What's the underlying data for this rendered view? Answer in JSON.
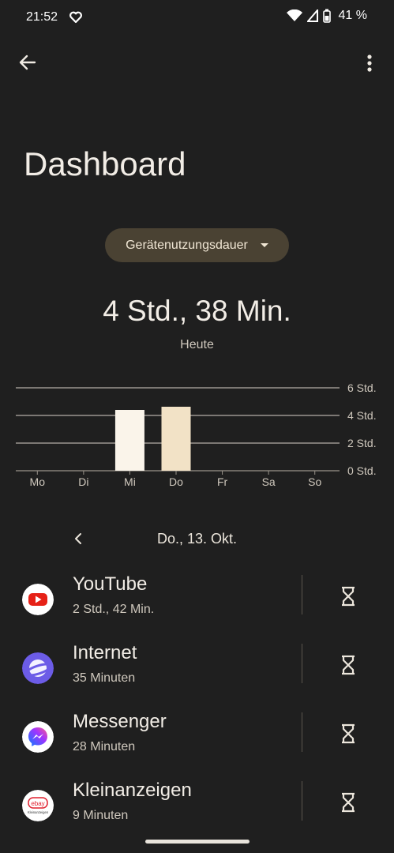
{
  "status_bar": {
    "time": "21:52",
    "battery_text": "41 %"
  },
  "header": {
    "title": "Dashboard"
  },
  "dropdown": {
    "label": "Gerätenutzungsdauer"
  },
  "summary": {
    "total": "4 Std., 38 Min.",
    "period": "Heute"
  },
  "chart_data": {
    "type": "bar",
    "categories": [
      "Mo",
      "Di",
      "Mi",
      "Do",
      "Fr",
      "Sa",
      "So"
    ],
    "values": [
      0,
      0,
      4.4,
      4.63,
      0,
      0,
      0
    ],
    "ytick_labels": [
      "6 Std.",
      "4 Std.",
      "2 Std.",
      "0 Std."
    ],
    "yticks": [
      6,
      4,
      2,
      0
    ],
    "ylim": [
      0,
      6
    ],
    "bar_colors": [
      "#faf4ea",
      "#f2e2c6"
    ],
    "highlight_index": 3,
    "grid": true,
    "axis_side": "right"
  },
  "day_nav": {
    "date": "Do., 13. Okt."
  },
  "apps": [
    {
      "name": "YouTube",
      "usage": "2 Std., 42 Min."
    },
    {
      "name": "Internet",
      "usage": "35 Minuten"
    },
    {
      "name": "Messenger",
      "usage": "28 Minuten"
    },
    {
      "name": "Kleinanzeigen",
      "usage": "9 Minuten"
    }
  ],
  "icons": {
    "youtube": "youtube-icon",
    "internet": "internet-icon",
    "messenger": "messenger-icon",
    "kleinanzeigen": "kleinanzeigen-icon",
    "kleinanzeigen_logo_text": "Kleinanzeigen",
    "kleinanzeigen_logo_brand": "ebay"
  }
}
